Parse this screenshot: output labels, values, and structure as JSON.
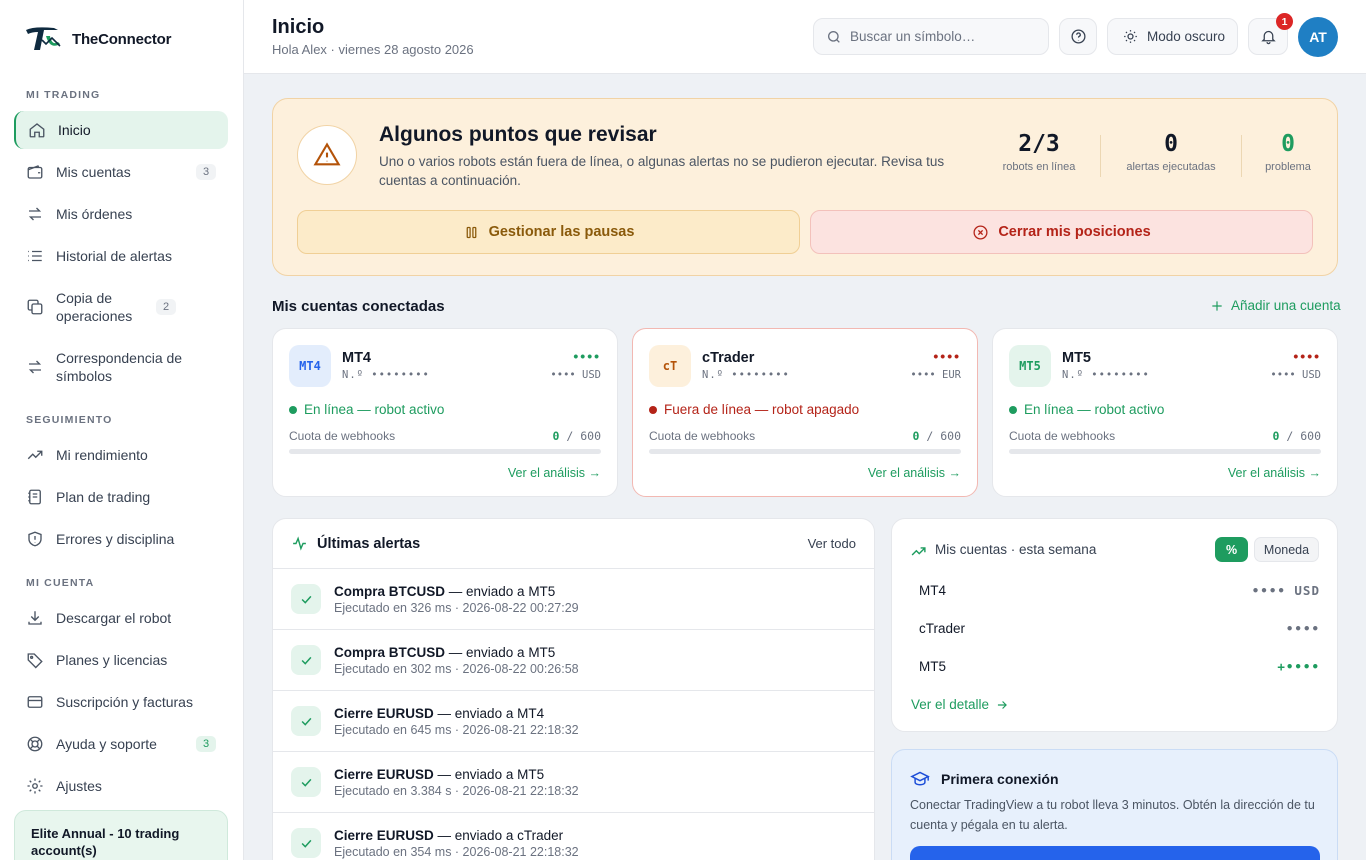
{
  "brand": {
    "name": "TheConnector"
  },
  "sidebar": {
    "sections": {
      "trading": "MI TRADING",
      "tracking": "SEGUIMIENTO",
      "account": "MI CUENTA"
    },
    "items": [
      {
        "label": "Inicio",
        "icon": "home-icon"
      },
      {
        "label": "Mis cuentas",
        "icon": "wallet-icon",
        "count": "3"
      },
      {
        "label": "Mis órdenes",
        "icon": "arrows-swap-icon"
      },
      {
        "label": "Historial de alertas",
        "icon": "list-icon"
      },
      {
        "label": "Copia de operaciones",
        "icon": "copy-icon",
        "count": "2"
      },
      {
        "label": "Correspondencia de símbolos",
        "icon": "arrows-swap-icon"
      },
      {
        "label": "Mi rendimiento",
        "icon": "trend-up-icon"
      },
      {
        "label": "Plan de trading",
        "icon": "notebook-icon"
      },
      {
        "label": "Errores y disciplina",
        "icon": "shield-alert-icon"
      },
      {
        "label": "Descargar el robot",
        "icon": "download-icon"
      },
      {
        "label": "Planes y licencias",
        "icon": "tag-icon"
      },
      {
        "label": "Suscripción y facturas",
        "icon": "credit-card-icon"
      },
      {
        "label": "Ayuda y soporte",
        "icon": "lifebuoy-icon",
        "count": "3"
      },
      {
        "label": "Ajustes",
        "icon": "gear-icon"
      }
    ],
    "plan": "Elite Annual - 10 trading account(s)"
  },
  "header": {
    "title": "Inicio",
    "subtitle": "Hola Alex · viernes 28 agosto 2026",
    "search_placeholder": "Buscar un símbolo…",
    "dark_mode_label": "Modo oscuro",
    "notifications_count": "1",
    "avatar_initials": "AT"
  },
  "banner": {
    "title": "Algunos puntos que revisar",
    "text": "Uno o varios robots están fuera de línea, o algunas alertas no se pudieron ejecutar. Revisa tus cuentas a continuación.",
    "stats": [
      {
        "value": "2/3",
        "label": "robots en línea"
      },
      {
        "value": "0",
        "label": "alertas ejecutadas"
      },
      {
        "value": "0",
        "label": "problema"
      }
    ],
    "pause_button": "Gestionar las pausas",
    "close_button": "Cerrar mis posiciones"
  },
  "accounts": {
    "title": "Mis cuentas conectadas",
    "add_label": "Añadir una cuenta",
    "items": [
      {
        "tile": "MT4",
        "name": "MT4",
        "number": "N.º ••••••••",
        "currency": "•••• USD",
        "dots": "••••",
        "status": "En línea — robot activo",
        "online": true,
        "quota_label": "Cuota de webhooks",
        "quota_used": "0",
        "quota_total": "600",
        "quota_fraction": 0,
        "link": "Ver el análisis →"
      },
      {
        "tile": "cT",
        "name": "cTrader",
        "number": "N.º ••••••••",
        "currency": "•••• EUR",
        "dots": "••••",
        "status": "Fuera de línea — robot apagado",
        "online": false,
        "quota_label": "Cuota de webhooks",
        "quota_used": "0",
        "quota_total": "600",
        "quota_fraction": 0,
        "link": "Ver el análisis →"
      },
      {
        "tile": "MT5",
        "name": "MT5",
        "number": "N.º ••••••••",
        "currency": "•••• USD",
        "dots": "••••",
        "status": "En línea — robot activo",
        "online": true,
        "quota_label": "Cuota de webhooks",
        "quota_used": "0",
        "quota_total": "600",
        "quota_fraction": 0,
        "link": "Ver el análisis →"
      }
    ]
  },
  "alerts": {
    "title": "Últimas alertas",
    "see_all": "Ver todo",
    "items": [
      {
        "action": "Compra BTCUSD",
        "target": " — enviado a MT5",
        "detail": "Ejecutado en 326 ms · 2026-08-22 00:27:29"
      },
      {
        "action": "Compra BTCUSD",
        "target": " — enviado a MT5",
        "detail": "Ejecutado en 302 ms · 2026-08-22 00:26:58"
      },
      {
        "action": "Cierre EURUSD",
        "target": " — enviado a MT4",
        "detail": "Ejecutado en 645 ms · 2026-08-21 22:18:32"
      },
      {
        "action": "Cierre EURUSD",
        "target": " — enviado a MT5",
        "detail": "Ejecutado en 3.384 s · 2026-08-21 22:18:32"
      },
      {
        "action": "Cierre EURUSD",
        "target": " — enviado a cTrader",
        "detail": "Ejecutado en 354 ms · 2026-08-21 22:18:32"
      }
    ]
  },
  "week": {
    "title": "Mis cuentas · esta semana",
    "toggle_percent": "%",
    "toggle_currency": "Moneda",
    "rows": [
      {
        "label": "MT4",
        "value": "•••• USD"
      },
      {
        "label": "cTrader",
        "value": "••••"
      },
      {
        "label": "MT5",
        "value": "+••••"
      }
    ],
    "detail_link": "Ver el detalle"
  },
  "first_connection": {
    "title": "Primera conexión",
    "text": "Conectar TradingView a tu robot lleva 3 minutos. Obtén la dirección de tu cuenta y pégala en tu alerta."
  },
  "colors": {
    "accent": "#1e9c5f",
    "danger": "#b42318",
    "warning_bg": "#fdf0dc",
    "info_bg": "#e7f0fc"
  }
}
